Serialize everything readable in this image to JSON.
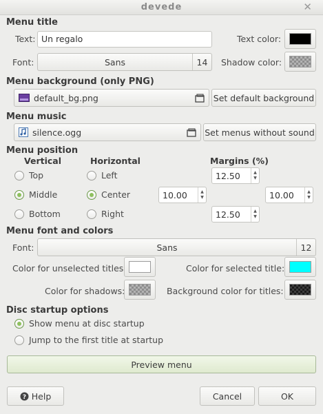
{
  "window": {
    "title": "devede",
    "close_glyph": "✕"
  },
  "menu_title": {
    "heading": "Menu title",
    "text_label": "Text:",
    "text_value": "Un regalo",
    "text_color_label": "Text color:",
    "text_color": "#000000",
    "font_label": "Font:",
    "font_name": "Sans",
    "font_size": "14",
    "shadow_color_label": "Shadow color:"
  },
  "menu_background": {
    "heading": "Menu background (only PNG)",
    "file": "default_bg.png",
    "default_button": "Set default background"
  },
  "menu_music": {
    "heading": "Menu music",
    "file": "silence.ogg",
    "no_sound_button": "Set menus without sound"
  },
  "menu_position": {
    "heading": "Menu position",
    "vertical_label": "Vertical",
    "horizontal_label": "Horizontal",
    "margins_label": "Margins (%)",
    "vertical_options": [
      "Top",
      "Middle",
      "Bottom"
    ],
    "vertical_selected": "Middle",
    "horizontal_options": [
      "Left",
      "Center",
      "Right"
    ],
    "horizontal_selected": "Center",
    "margin_top": "12.50",
    "margin_left": "10.00",
    "margin_right": "10.00",
    "margin_bottom": "12.50"
  },
  "menu_font_colors": {
    "heading": "Menu font and colors",
    "font_label": "Font:",
    "font_name": "Sans",
    "font_size": "12",
    "unselected_label": "Color for unselected titles:",
    "unselected_color": "#ffffff",
    "selected_label": "Color for selected title:",
    "selected_color": "#00ffff",
    "shadows_label": "Color for shadows:",
    "background_titles_label": "Background color for titles:"
  },
  "disc_startup": {
    "heading": "Disc startup options",
    "show_menu": "Show menu at disc startup",
    "jump_first": "Jump to the first title at startup",
    "selected": "show_menu"
  },
  "actions": {
    "preview": "Preview menu",
    "help": "Help",
    "cancel": "Cancel",
    "ok": "OK"
  }
}
